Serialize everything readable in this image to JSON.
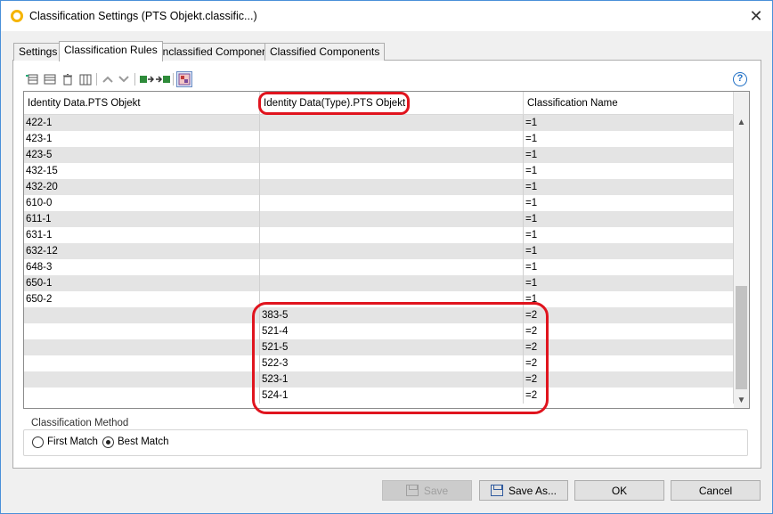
{
  "window": {
    "title": "Classification Settings (PTS Objekt.classific...)",
    "close_glyph": "✕"
  },
  "tabs": [
    {
      "label": "Settings",
      "active": false
    },
    {
      "label": "Classification Rules",
      "active": true
    },
    {
      "label": "Unclassified Components",
      "active": false
    },
    {
      "label": "Classified Components",
      "active": false
    }
  ],
  "toolbar": {
    "icons": [
      "add-row-icon",
      "insert-row-icon",
      "delete-row-icon",
      "add-column-icon",
      "move-up-icon",
      "move-down-icon",
      "import-icon",
      "export-icon",
      "color-settings-icon"
    ],
    "help_glyph": "?"
  },
  "table": {
    "columns": [
      "Identity Data.PTS Objekt",
      "Identity Data(Type).PTS Objekt",
      "Classification Name"
    ],
    "rows": [
      [
        "422-1",
        "",
        "=1"
      ],
      [
        "423-1",
        "",
        "=1"
      ],
      [
        "423-5",
        "",
        "=1"
      ],
      [
        "432-15",
        "",
        "=1"
      ],
      [
        "432-20",
        "",
        "=1"
      ],
      [
        "610-0",
        "",
        "=1"
      ],
      [
        "611-1",
        "",
        "=1"
      ],
      [
        "631-1",
        "",
        "=1"
      ],
      [
        "632-12",
        "",
        "=1"
      ],
      [
        "648-3",
        "",
        "=1"
      ],
      [
        "650-1",
        "",
        "=1"
      ],
      [
        "650-2",
        "",
        "=1"
      ],
      [
        "",
        "383-5",
        "=2"
      ],
      [
        "",
        "521-4",
        "=2"
      ],
      [
        "",
        "521-5",
        "=2"
      ],
      [
        "",
        "522-3",
        "=2"
      ],
      [
        "",
        "523-1",
        "=2"
      ],
      [
        "",
        "524-1",
        "=2"
      ]
    ]
  },
  "classification_method": {
    "label": "Classification Method",
    "options": [
      {
        "label": "First Match",
        "checked": false
      },
      {
        "label": "Best Match",
        "checked": true
      }
    ]
  },
  "buttons": {
    "save": "Save",
    "save_as": "Save As...",
    "ok": "OK",
    "cancel": "Cancel"
  },
  "colors": {
    "highlight": "#e0141e",
    "row_alt": "#e4e4e4",
    "accent": "#1f6fc5"
  }
}
